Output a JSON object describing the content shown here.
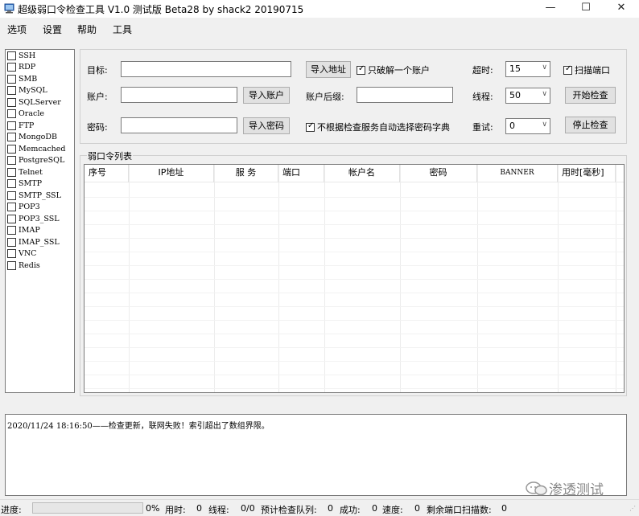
{
  "window": {
    "title": "超级弱口令检查工具 V1.0 测试版 Beta28 by shack2 20190715",
    "minimize": "—",
    "maximize": "☐",
    "close": "✕"
  },
  "menu": [
    "选项",
    "设置",
    "帮助",
    "工具"
  ],
  "services": [
    "SSH",
    "RDP",
    "SMB",
    "MySQL",
    "SQLServer",
    "Oracle",
    "FTP",
    "MongoDB",
    "Memcached",
    "PostgreSQL",
    "Telnet",
    "SMTP",
    "SMTP_SSL",
    "POP3",
    "POP3_SSL",
    "IMAP",
    "IMAP_SSL",
    "VNC",
    "Redis"
  ],
  "config": {
    "target_label": "目标:",
    "target_value": "",
    "import_address": "导入地址",
    "crack_one": {
      "label": "只破解一个账户",
      "checked": true
    },
    "timeout_label": "超时:",
    "timeout_value": "15",
    "scan_port": {
      "label": "扫描端口",
      "checked": true
    },
    "account_label": "账户:",
    "account_value": "",
    "import_account": "导入账户",
    "suffix_label": "账户后缀:",
    "suffix_value": "",
    "threads_label": "线程:",
    "threads_value": "50",
    "start_button": "开始检查",
    "password_label": "密码:",
    "password_value": "",
    "import_password": "导入密码",
    "no_auto_dict": {
      "label": "不根据检查服务自动选择密码字典",
      "checked": true
    },
    "retry_label": "重试:",
    "retry_value": "0",
    "stop_button": "停止检查"
  },
  "results": {
    "group_title": "弱口令列表",
    "columns": [
      "序号",
      "IP地址",
      "服 务",
      "端口",
      "帐户名",
      "密码",
      "BANNER",
      "用时[毫秒]"
    ],
    "rows": []
  },
  "log": {
    "lines": [
      "2020/11/24 18:16:50——检查更新，联网失败！索引超出了数组界限。"
    ]
  },
  "watermark": "渗透测试",
  "status": {
    "progress_label": "进度:",
    "progress_value": 0,
    "percent": "0%",
    "time_label": "用时:",
    "time_value": "0",
    "threads_label": "线程:",
    "threads_value": "0/0",
    "queue_label": "预计检查队列:",
    "queue_value": "0",
    "success_label": "成功:",
    "success_value": "0",
    "speed_label": "速度:",
    "speed_value": "0",
    "remaining_label": "剩余端口扫描数:",
    "remaining_value": "0"
  }
}
